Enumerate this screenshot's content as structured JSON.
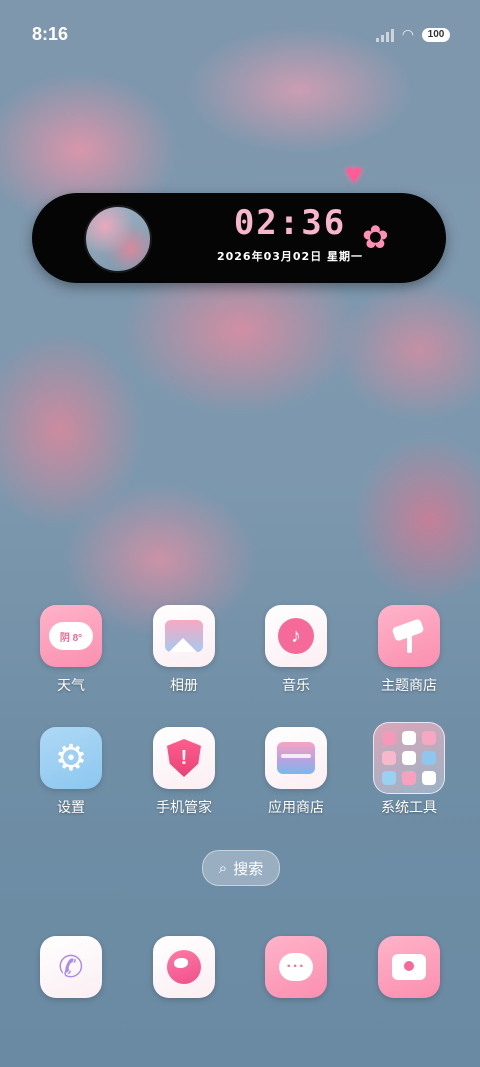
{
  "status_bar": {
    "time": "8:16",
    "battery": "100"
  },
  "clock_widget": {
    "time": "02:36",
    "date": "2026年03月02日 星期一"
  },
  "apps": [
    {
      "label": "天气",
      "badge": "阴 8°"
    },
    {
      "label": "相册"
    },
    {
      "label": "音乐"
    },
    {
      "label": "主题商店"
    },
    {
      "label": "设置"
    },
    {
      "label": "手机管家"
    },
    {
      "label": "应用商店"
    },
    {
      "label": "系统工具"
    }
  ],
  "search": {
    "label": "搜索"
  },
  "colors": {
    "accent_pink": "#fb8fb0",
    "clock_pink": "#f7b6cb",
    "settings_blue": "#8cc7ef"
  }
}
